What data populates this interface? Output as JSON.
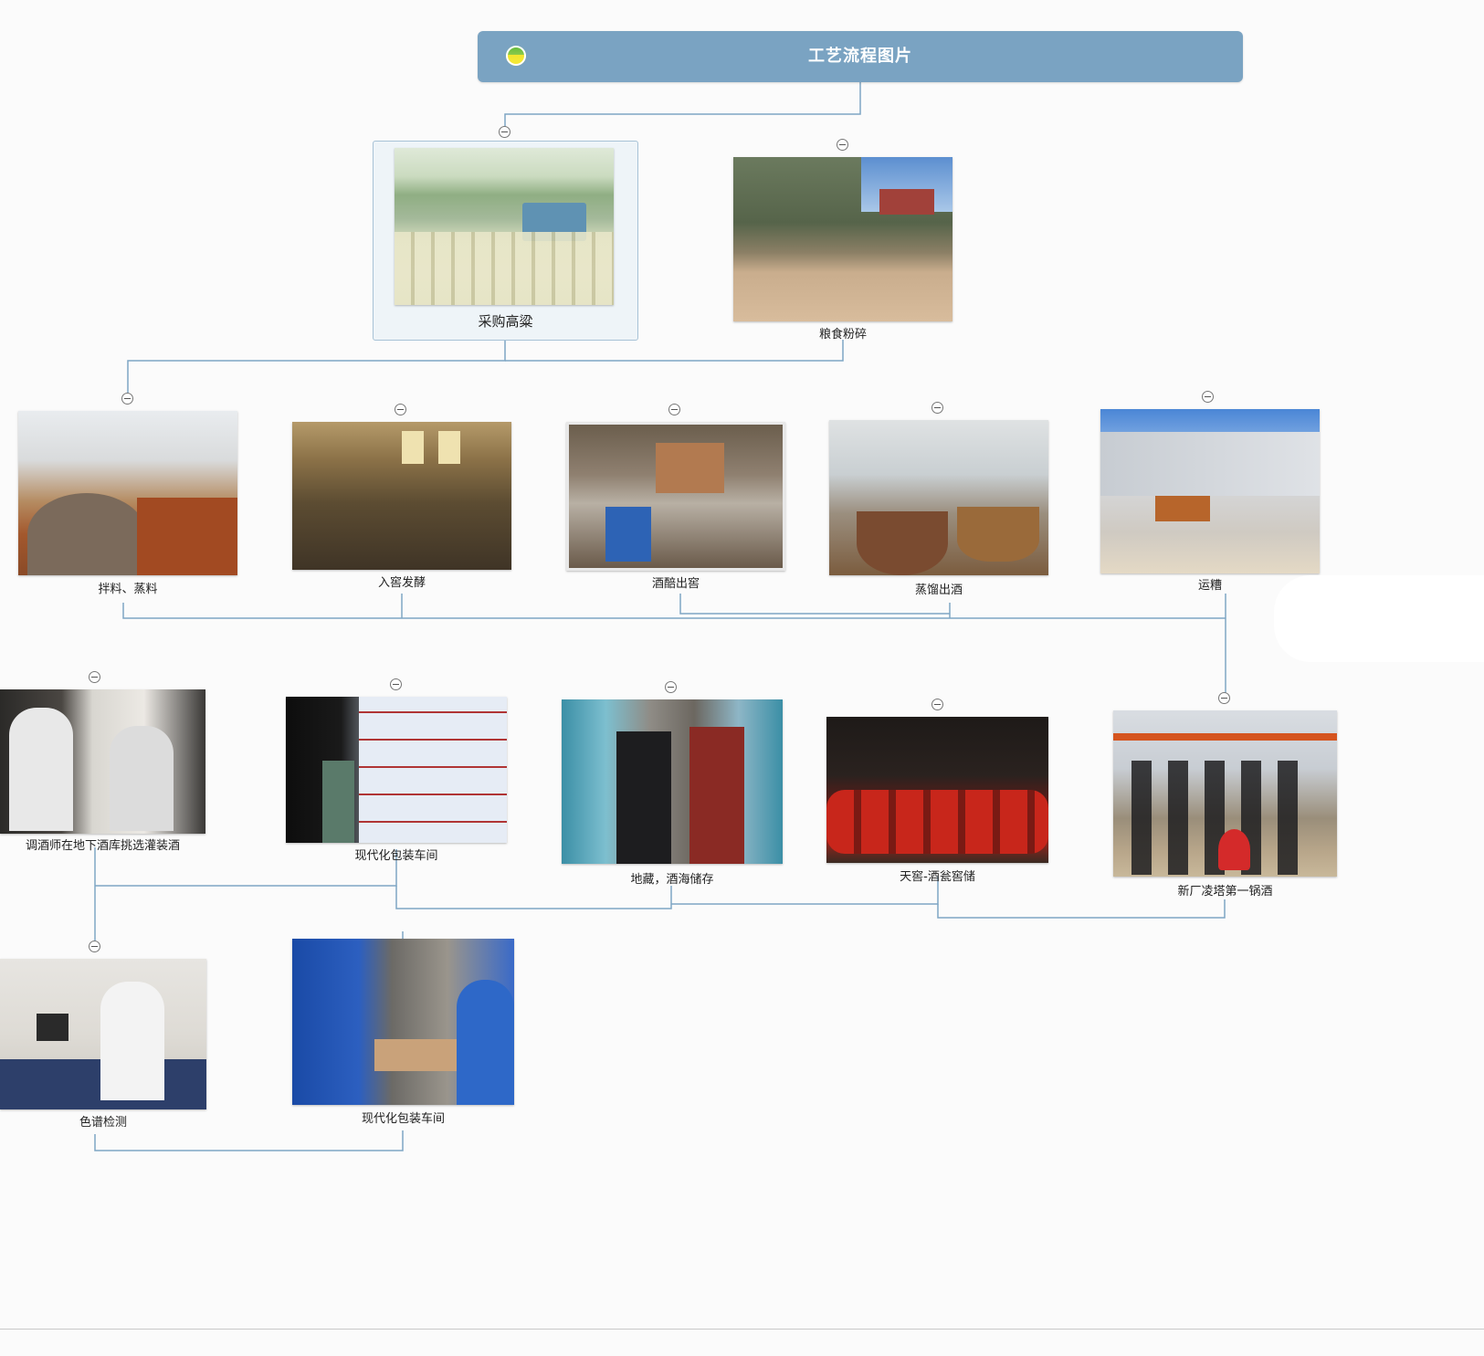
{
  "root": {
    "title": "工艺流程图片"
  },
  "nodes": [
    {
      "id": "n1",
      "label": "采购高粱"
    },
    {
      "id": "n2",
      "label": "粮食粉碎"
    },
    {
      "id": "n3",
      "label": "拌料、蒸料"
    },
    {
      "id": "n4",
      "label": "入窖发酵"
    },
    {
      "id": "n5",
      "label": "酒醅出窖"
    },
    {
      "id": "n6",
      "label": "蒸馏出酒"
    },
    {
      "id": "n7",
      "label": "运糟"
    },
    {
      "id": "n8",
      "label": "调酒师在地下酒库挑选灌装酒"
    },
    {
      "id": "n9",
      "label": "现代化包装车间"
    },
    {
      "id": "n10",
      "label": "地藏，酒海储存"
    },
    {
      "id": "n11",
      "label": "天窖-酒瓮窖储"
    },
    {
      "id": "n12",
      "label": "新厂凌塔第一锅酒"
    },
    {
      "id": "n13",
      "label": "色谱检测"
    },
    {
      "id": "n14",
      "label": "现代化包装车间"
    }
  ],
  "colors": {
    "root": "#7aa3c2",
    "connector": "#7ea6c4"
  }
}
